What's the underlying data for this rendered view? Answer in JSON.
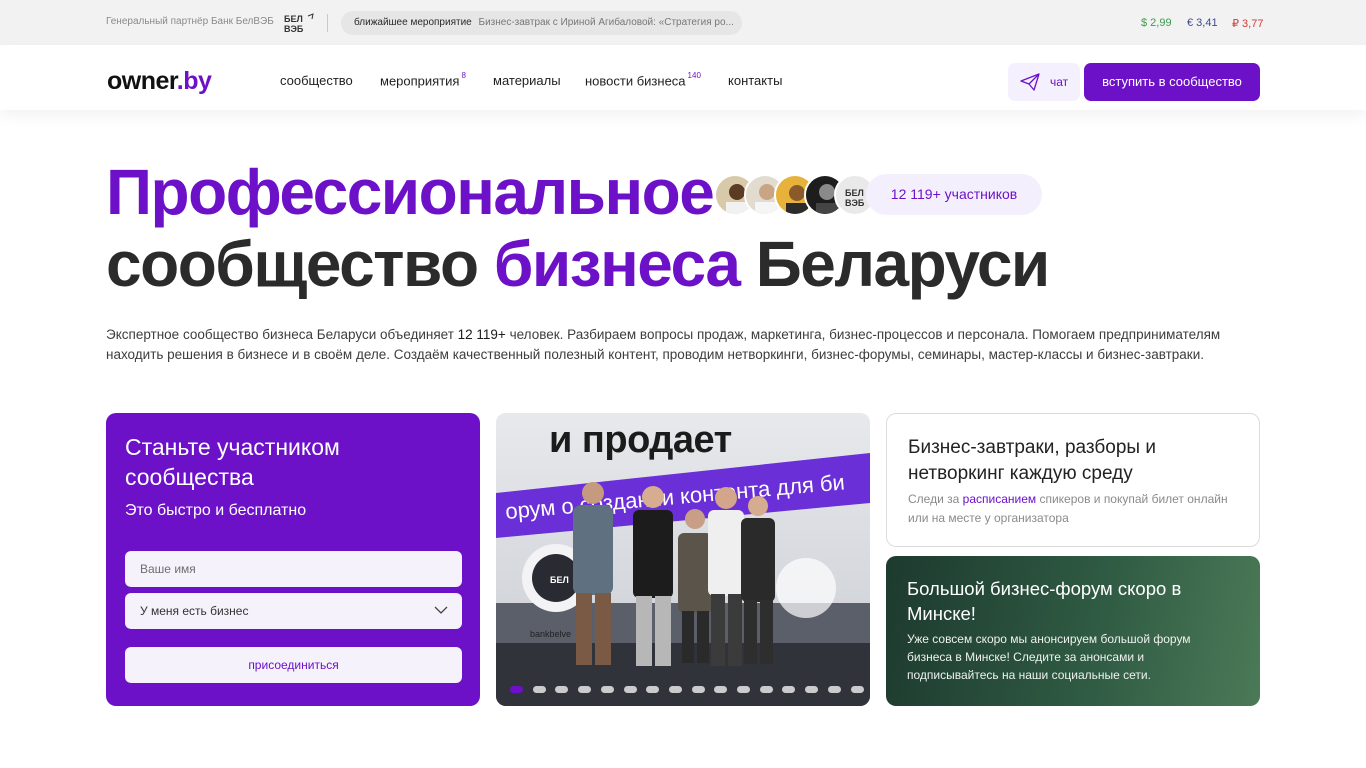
{
  "topbar": {
    "partner_text": "Генеральный партнёр Банк БелВЭБ",
    "partner_logo_text": [
      "БЕЛ",
      "ВЭБ"
    ],
    "event_label": "ближайшее мероприятие",
    "event_text": "Бизнес-завтрак с Ириной Агибаловой: «Стратегия ро...",
    "currencies": {
      "usd": "$ 2,99",
      "eur": "€ 3,41",
      "rub": "₽ 3,77"
    }
  },
  "header": {
    "logo_main": "owner",
    "logo_suffix": ".by",
    "nav": [
      {
        "label": "сообщество",
        "badge": ""
      },
      {
        "label": "мероприятия",
        "badge": "8"
      },
      {
        "label": "материалы",
        "badge": ""
      },
      {
        "label": "новости бизнеса",
        "badge": "140"
      },
      {
        "label": "контакты",
        "badge": ""
      }
    ],
    "chat_label": "чат",
    "chat_icon": "paper-plane-icon",
    "join_label": "вступить в сообщество"
  },
  "hero": {
    "line1": "Профессиональное",
    "line2_part1": "сообщество ",
    "line2_accent": "бизнеса",
    "line2_part3": " Беларуси",
    "members_badge": "12 119+ участников",
    "description_before": "Экспертное сообщество бизнеса Беларуси объединяет ",
    "description_count": "12 119+",
    "description_after": " человек. Разбираем вопросы продаж, маркетинга, бизнес-процессов и персонала. Помогаем предпринимателям находить решения в бизнесе и в своём деле. Создаём качественный полезный контент, проводим нетворкинги, бизнес-форумы, семинары, мастер-классы и бизнес-завтраки."
  },
  "join_card": {
    "title": "Станьте участником сообщества",
    "subtitle": "Это быстро и бесплатно",
    "name_placeholder": "Ваше имя",
    "select_value": "У меня есть бизнес",
    "submit_label": "присоединиться"
  },
  "slider": {
    "headline": "и продает",
    "banner_text": "орум о создании контента для би",
    "logo_small": "БЕЛ",
    "caption": "bankbelve",
    "slide_count": 16,
    "active_index": 0
  },
  "breakfast_card": {
    "title": "Бизнес-завтраки, разборы и нетворкинг каждую среду",
    "text_before": "Следи за ",
    "text_link": "расписанием",
    "text_after": " спикеров и покупай билет онлайн или на месте у организатора"
  },
  "forum_card": {
    "title": "Большой бизнес-форум скоро в Минске!",
    "text": "Уже совсем скоро мы анонсируем большой форум бизнеса в Минске! Следите за анонсами и подписывайтесь на наши социальные сети."
  },
  "colors": {
    "accent": "#6d11c9",
    "usd": "#3e9a4e",
    "eur": "#3e4a8a",
    "rub": "#d23b3b"
  }
}
